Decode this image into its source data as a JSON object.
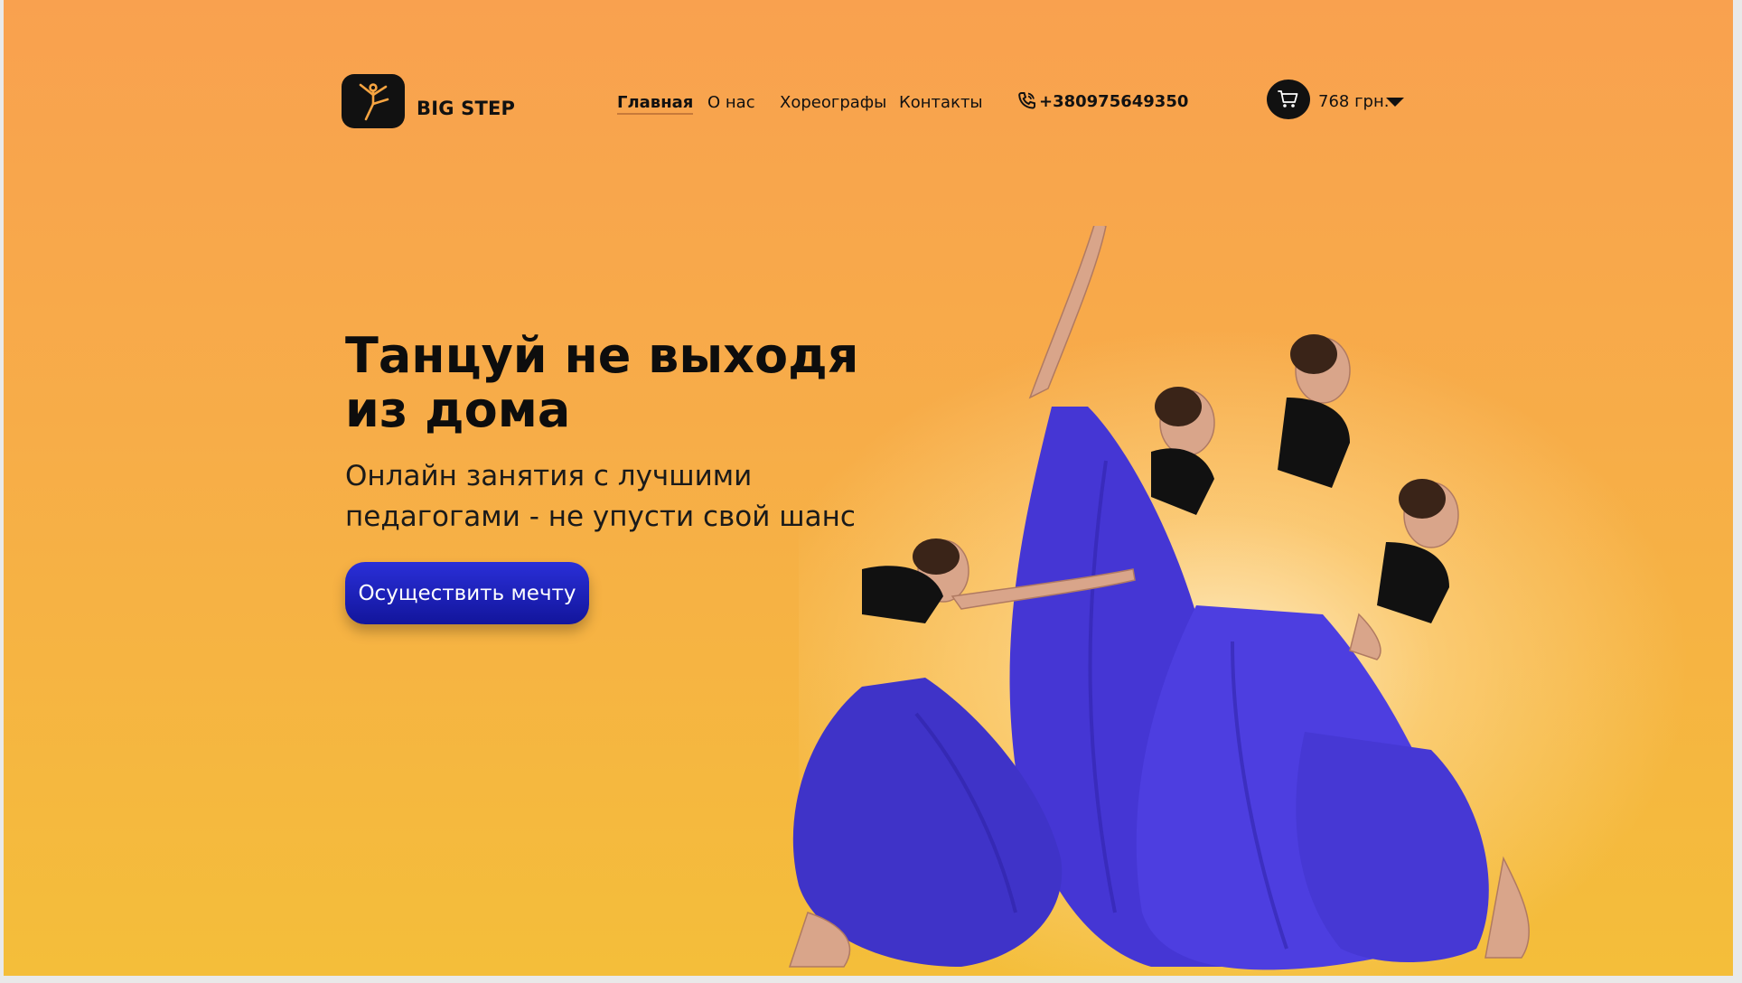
{
  "brand": {
    "name": "BIG STEP",
    "logo_icon": "dancer-icon"
  },
  "nav": {
    "items": [
      {
        "label": "Главная",
        "active": true
      },
      {
        "label": "О нас",
        "active": false
      },
      {
        "label": "Хореографы",
        "active": false
      },
      {
        "label": "Контакты",
        "active": false
      }
    ]
  },
  "contact": {
    "phone": "+380975649350",
    "icon": "phone-icon"
  },
  "cart": {
    "price": "768 грн.",
    "icon": "cart-icon"
  },
  "hero": {
    "title_line1": "Танцуй не выходя",
    "title_line2": "из дома",
    "subtitle_line1": "Онлайн занятия с лучшими",
    "subtitle_line2": "педагогами - не упусти свой шанс",
    "cta_label": "Осуществить мечту"
  },
  "colors": {
    "bg_top": "#f9a14f",
    "bg_bottom": "#f4be3a",
    "cta": "#1f22c2",
    "dress": "#4a3fd6"
  }
}
